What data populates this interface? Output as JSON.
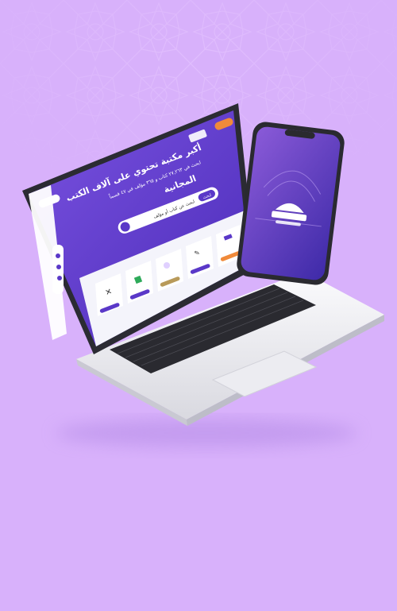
{
  "hero": {
    "headline_line1": "أكبر مكتبة تحتوي على آلاف الكتب",
    "headline_line2": "المجانية",
    "subline": "ابحث في ٢٧,٢٦٣ كتاب و ٣٦٥ مؤلف في ٤٧ قسماً",
    "search_button": "ابحث",
    "search_placeholder": "ابحث عن كتاب أو مؤلف"
  },
  "colors": {
    "background": "#d8b1fb",
    "screen_purple": "#5a38c8",
    "accent_orange": "#f08a3a",
    "laptop_silver": "#f2f2f5"
  },
  "icons": [
    "logo-icon",
    "search-icon",
    "book-icon",
    "user-icon",
    "menu-icon"
  ]
}
